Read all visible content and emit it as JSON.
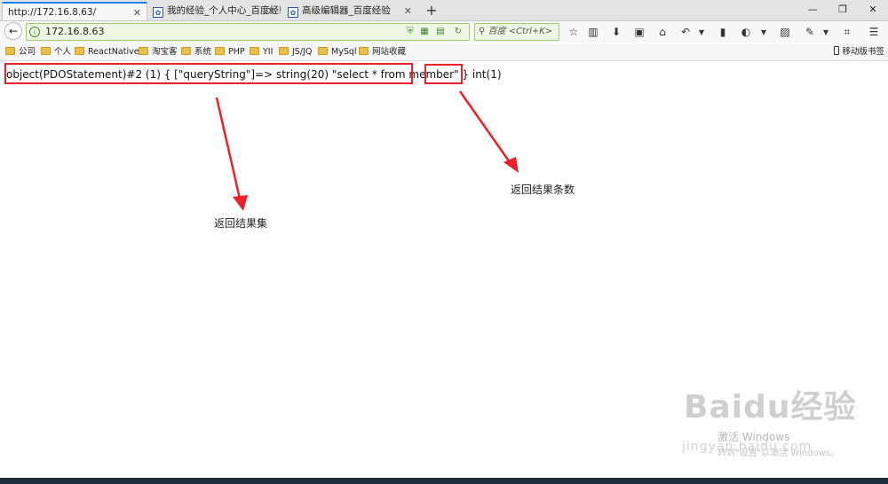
{
  "tabs": [
    {
      "label": "http://172.16.8.63/",
      "active": true
    },
    {
      "label": "我的经验_个人中心_百度经验",
      "active": false
    },
    {
      "label": "高级编辑器_百度经验",
      "active": false
    }
  ],
  "new_tab": "+",
  "window_controls": {
    "minimize": "—",
    "maximize": "❐",
    "close": "✕"
  },
  "nav": {
    "back": "←",
    "url": "172.16.8.63",
    "search_placeholder": "百度 <Ctrl+K>"
  },
  "bookmarks": [
    "公司",
    "个人",
    "ReactNative",
    "淘宝客",
    "系统",
    "PHP",
    "YII",
    "JS/JQ",
    "MySql",
    "网站收藏"
  ],
  "mobile_bookmarks": "移动版书签",
  "page": {
    "dump_line": "object(PDOStatement)#2 (1) { [\"queryString\"]=> string(20) \"select * from member\" } int(1)"
  },
  "annotations": {
    "result_set": "返回结果集",
    "result_count": "返回结果条数"
  },
  "colors": {
    "annotation_red": "#e8212b",
    "urlbar_green": "#eef7e3",
    "taskbar": "#1f2f42"
  },
  "watermark": {
    "brand": "Baidu经验",
    "url": "jingyan.baidu.com"
  },
  "windows_activation": {
    "line1": "激活 Windows",
    "line2": "转到\"设置\"以激活 Windows。"
  }
}
